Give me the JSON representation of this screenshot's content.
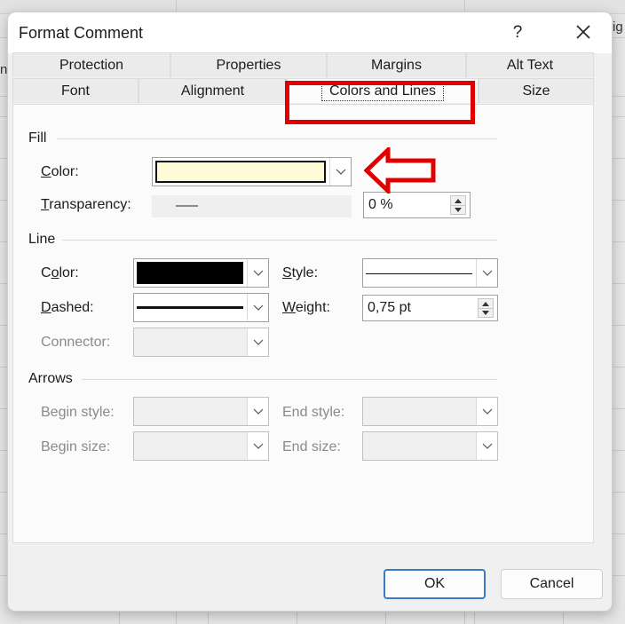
{
  "background": {
    "partial_text": "ig",
    "partial_text_left": "n"
  },
  "dialog": {
    "title": "Format Comment",
    "help_label": "?",
    "close_icon": "close-icon"
  },
  "tabs": {
    "back_row": [
      {
        "label": "Protection"
      },
      {
        "label": "Properties"
      },
      {
        "label": "Margins"
      },
      {
        "label": "Alt Text"
      }
    ],
    "front_row": [
      {
        "label": "Font"
      },
      {
        "label": "Alignment"
      },
      {
        "label": "Colors and Lines",
        "active": true
      },
      {
        "label": "Size"
      }
    ]
  },
  "fill": {
    "heading": "Fill",
    "color_label_u": "C",
    "color_label_rest": "olor:",
    "color_value": "#fffbd9",
    "transparency_label_u": "T",
    "transparency_label_rest": "ransparency:",
    "transparency_value": "0 %",
    "transparency_percent": 0
  },
  "line": {
    "heading": "Line",
    "color_label_a": "C",
    "color_label_u": "o",
    "color_label_rest": "lor:",
    "color_value": "#000000",
    "dashed_label_u": "D",
    "dashed_label_rest": "ashed:",
    "connector_label": "Connector:",
    "style_label_u": "S",
    "style_label_rest": "tyle:",
    "weight_label_u": "W",
    "weight_label_rest": "eight:",
    "weight_value": "0,75 pt"
  },
  "arrows": {
    "heading": "Arrows",
    "begin_style_label": "Begin style:",
    "begin_size_label": "Begin size:",
    "end_style_label": "End style:",
    "end_size_label": "End size:"
  },
  "buttons": {
    "ok": "OK",
    "cancel": "Cancel"
  },
  "annotations": {
    "highlight_color": "#e00000"
  }
}
